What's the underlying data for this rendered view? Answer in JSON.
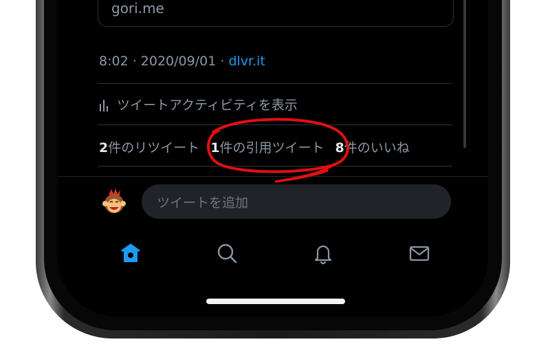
{
  "link_card": {
    "domain": "gori.me"
  },
  "meta": {
    "time": "8:02",
    "separator": " · ",
    "date": "2020/09/01",
    "source": "dlvr.it"
  },
  "activity": {
    "label": "ツイートアクティビティを表示",
    "icon": "bar-chart-icon"
  },
  "stats": {
    "retweets": {
      "count": "2",
      "label": "件のリツイート"
    },
    "quotes": {
      "count": "1",
      "label": "件の引用ツイート"
    },
    "likes": {
      "count": "8",
      "label": "件のいいね"
    }
  },
  "reply": {
    "placeholder": "ツイートを追加",
    "avatar": "monkey-avatar"
  },
  "tabbar": {
    "items": [
      {
        "icon": "home-icon",
        "active": true
      },
      {
        "icon": "search-icon",
        "active": false
      },
      {
        "icon": "bell-icon",
        "active": false
      },
      {
        "icon": "mail-icon",
        "active": false
      }
    ]
  },
  "colors": {
    "accent": "#1d9bf0",
    "annotation": "#e01010",
    "background": "#000000",
    "muted_text": "#8b98a5"
  }
}
